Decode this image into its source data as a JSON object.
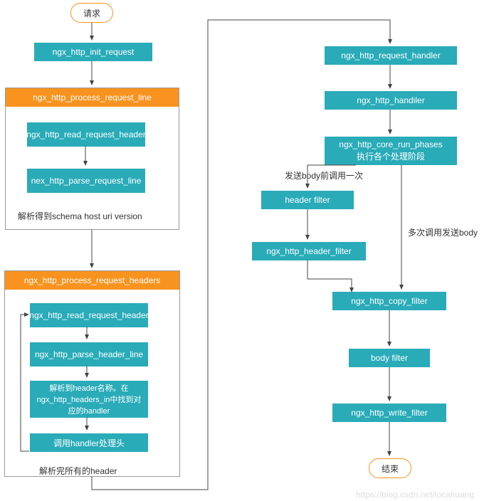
{
  "terminals": {
    "start": "请求",
    "end": "结束"
  },
  "nodes": {
    "init_request": "ngx_http_init_request",
    "request_handler": "ngx_http_request_handler",
    "handiler": "ngx_http_handiler",
    "core_run_phases_1": "ngx_http_core_run_phases",
    "core_run_phases_2": "执行各个处理阶段",
    "header_filter": "header filter",
    "http_header_filter": "ngx_http_header_filter",
    "copy_filter": "ngx_http_copy_filter",
    "body_filter": "body filter",
    "write_filter": "ngx_http_write_filter"
  },
  "containers": {
    "c1_title": "ngx_http_process_request_line",
    "c1_n1": "ngx_http_read_request_header",
    "c1_n2": "nex_http_parse_request_line",
    "c2_title": "ngx_http_process_request_headers",
    "c2_n1": "ngx_http_read_request_header",
    "c2_n2": "ngx_http_parse_header_line",
    "c2_n3": "解析到header名称。在ngx_http_headers_in中找到对应的handler",
    "c2_n4": "调用handler处理头"
  },
  "labels": {
    "l1": "解析得到schema host uri version",
    "l2": "解析完所有的header",
    "l3": "发送body前调用一次",
    "l4": "多次调用发送body"
  },
  "watermark": "https://blog.csdn.net/locahuang"
}
